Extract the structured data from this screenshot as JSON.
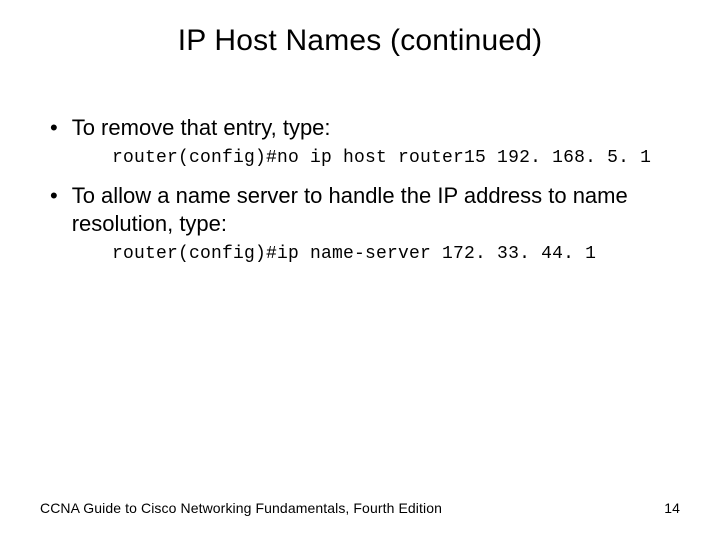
{
  "title": "IP Host Names (continued)",
  "bullets": [
    {
      "text": "To remove that entry, type:",
      "code": "router(config)#no ip host router15 192. 168. 5. 1"
    },
    {
      "text": "To allow a name server to handle the IP address to name resolution, type:",
      "code": "router(config)#ip name-server 172. 33. 44. 1"
    }
  ],
  "footer": {
    "left": "CCNA Guide to Cisco Networking Fundamentals, Fourth Edition",
    "right": "14"
  }
}
